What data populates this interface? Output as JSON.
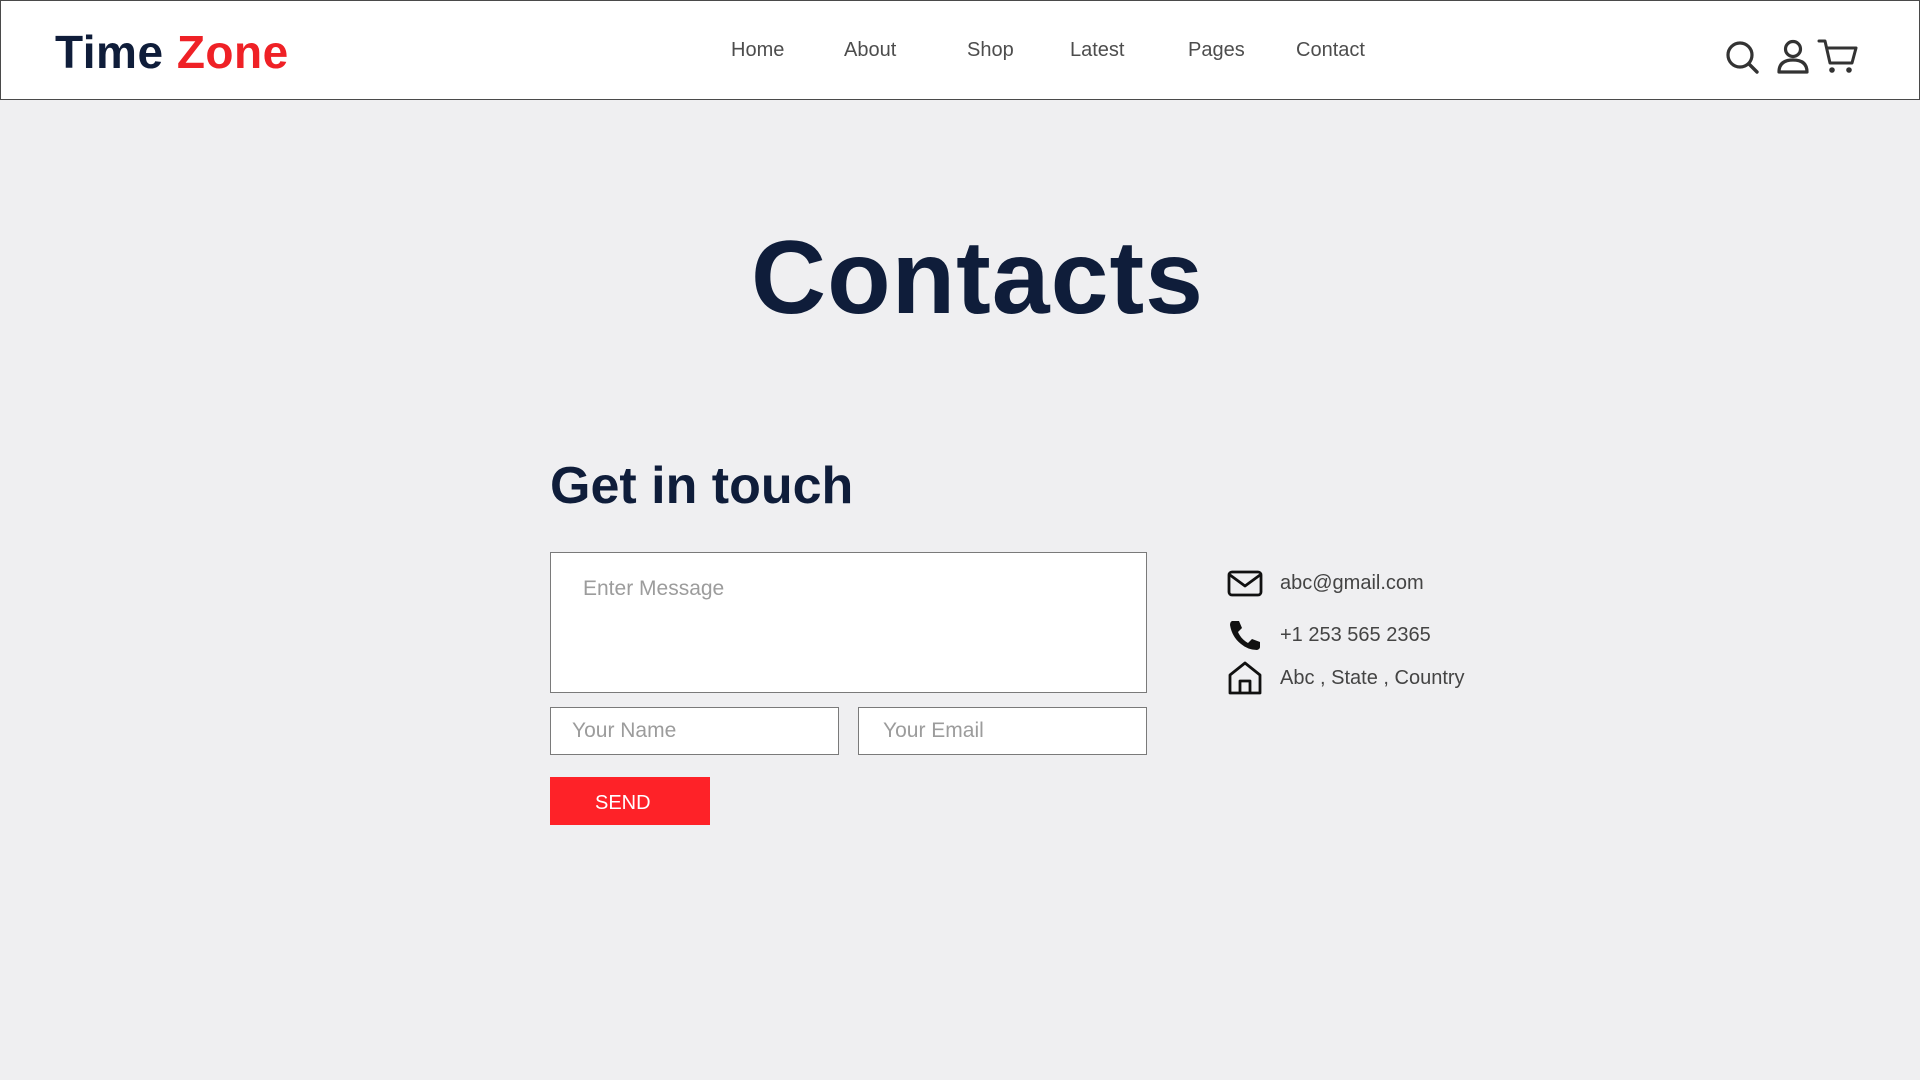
{
  "brand": {
    "word1": "Time",
    "word2": "Zone",
    "accent_color": "#ef2126",
    "dark_color": "#0f1d3a"
  },
  "nav": {
    "items": [
      "Home",
      "About",
      "Shop",
      "Latest",
      "Pages",
      "Contact"
    ]
  },
  "header_icons": [
    "search-icon",
    "user-icon",
    "cart-icon"
  ],
  "page": {
    "title": "Contacts"
  },
  "form": {
    "title": "Get in touch",
    "message_placeholder": "Enter Message",
    "name_placeholder": "Your Name",
    "email_placeholder": "Your Email",
    "send_label": "SEND",
    "send_color": "#fe2228"
  },
  "contact_info": [
    {
      "icon": "mail-icon",
      "text": "abc@gmail.com"
    },
    {
      "icon": "phone-icon",
      "text": "+1 253 565 2365"
    },
    {
      "icon": "home-icon",
      "text": "Abc , State , Country"
    }
  ]
}
